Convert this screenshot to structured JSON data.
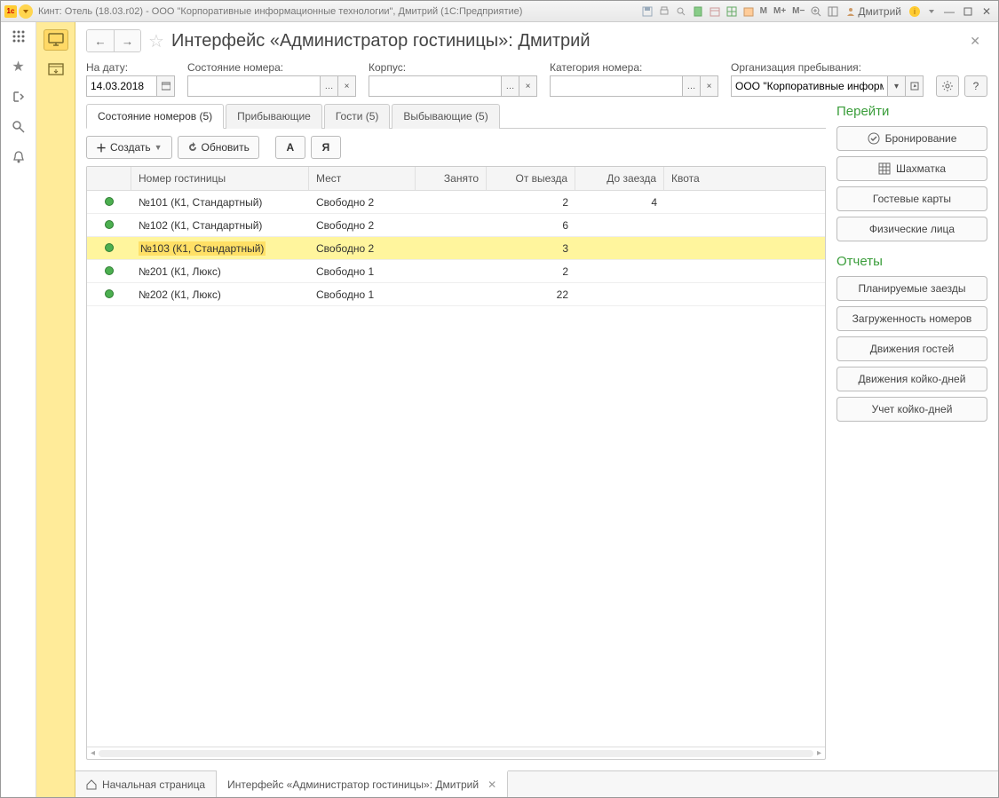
{
  "titlebar": {
    "text": "Кинт: Отель (18.03.r02) - ООО \"Корпоративные информационные технологии\", Дмитрий  (1С:Предприятие)",
    "user": "Дмитрий"
  },
  "page": {
    "title": "Интерфейс «Администратор гостиницы»: Дмитрий"
  },
  "filters": {
    "date": {
      "label": "На дату:",
      "value": "14.03.2018"
    },
    "room_state": {
      "label": "Состояние номера:",
      "value": ""
    },
    "building": {
      "label": "Корпус:",
      "value": ""
    },
    "category": {
      "label": "Категория номера:",
      "value": ""
    },
    "org": {
      "label": "Организация пребывания:",
      "value": "ООО \"Корпоративные информ"
    }
  },
  "tabs": [
    {
      "label": "Состояние номеров (5)",
      "active": true
    },
    {
      "label": "Прибывающие",
      "active": false
    },
    {
      "label": "Гости (5)",
      "active": false
    },
    {
      "label": "Выбывающие (5)",
      "active": false
    }
  ],
  "toolbar": {
    "create": "Создать",
    "refresh": "Обновить",
    "a": "А",
    "ya": "Я"
  },
  "grid": {
    "headers": {
      "room": "Номер гостиницы",
      "mest": "Мест",
      "zanyato": "Занято",
      "ot": "От выезда",
      "do": "До заезда",
      "kvota": "Квота"
    },
    "rows": [
      {
        "room": "№101 (К1, Стандартный)",
        "mest": "Свободно 2",
        "zanyato": "",
        "ot": "2",
        "do": "4",
        "kv": "",
        "selected": false
      },
      {
        "room": "№102 (К1, Стандартный)",
        "mest": "Свободно 2",
        "zanyato": "",
        "ot": "6",
        "do": "",
        "kv": "",
        "selected": false
      },
      {
        "room": "№103 (К1, Стандартный)",
        "mest": "Свободно 2",
        "zanyato": "",
        "ot": "3",
        "do": "",
        "kv": "",
        "selected": true
      },
      {
        "room": "№201 (К1, Люкс)",
        "mest": "Свободно 1",
        "zanyato": "",
        "ot": "2",
        "do": "",
        "kv": "",
        "selected": false
      },
      {
        "room": "№202 (К1, Люкс)",
        "mest": "Свободно 1",
        "zanyato": "",
        "ot": "22",
        "do": "",
        "kv": "",
        "selected": false
      }
    ]
  },
  "side": {
    "goto": "Перейти",
    "goto_items": [
      {
        "label": "Бронирование",
        "icon": "check"
      },
      {
        "label": "Шахматка",
        "icon": "grid"
      },
      {
        "label": "Гостевые карты",
        "icon": ""
      },
      {
        "label": "Физические лица",
        "icon": ""
      }
    ],
    "reports": "Отчеты",
    "report_items": [
      {
        "label": "Планируемые заезды"
      },
      {
        "label": "Загруженность номеров"
      },
      {
        "label": "Движения гостей"
      },
      {
        "label": "Движения койко-дней"
      },
      {
        "label": "Учет койко-дней"
      }
    ]
  },
  "bottom_tabs": {
    "home": "Начальная страница",
    "current": "Интерфейс «Администратор гостиницы»: Дмитрий"
  }
}
